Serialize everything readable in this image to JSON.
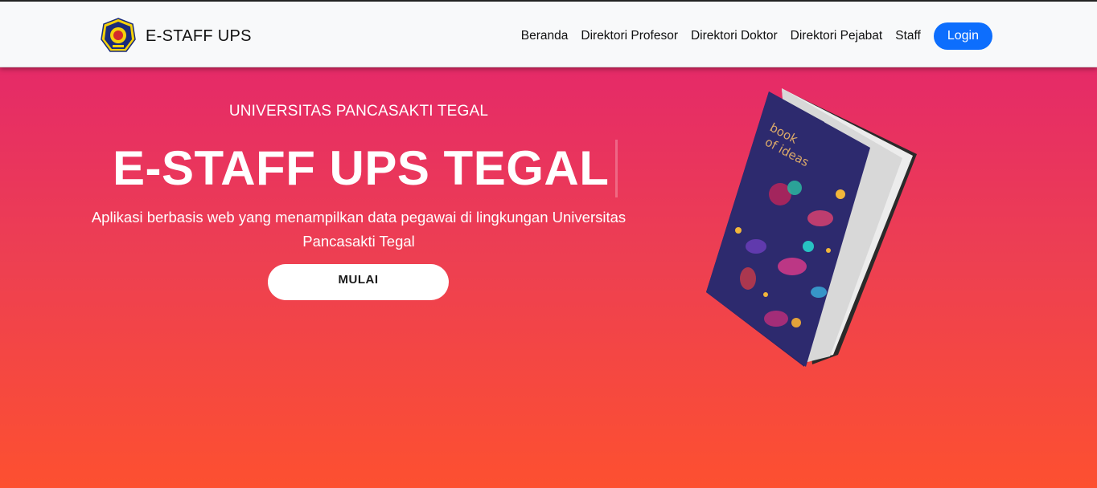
{
  "brand": {
    "name": "E-STAFF UPS",
    "logo_icon": "university-seal-icon"
  },
  "nav": {
    "items": [
      {
        "label": "Beranda"
      },
      {
        "label": "Direktori Profesor"
      },
      {
        "label": "Direktori Doktor"
      },
      {
        "label": "Direktori Pejabat"
      },
      {
        "label": "Staff"
      }
    ],
    "login_label": "Login"
  },
  "hero": {
    "university": "UNIVERSITAS PANCASAKTI TEGAL",
    "title": "E-STAFF UPS TEGAL",
    "description": "Aplikasi berbasis web yang menampilkan data pegawai di lingkungan Universitas Pancasakti Tegal",
    "cta_label": "MULAI",
    "illustration": "book-of-ideas-illustration"
  },
  "colors": {
    "navbar_bg": "#f8f9fa",
    "accent": "#0d6efd",
    "hero_top": "#e52a68",
    "hero_bottom": "#fd5030"
  }
}
